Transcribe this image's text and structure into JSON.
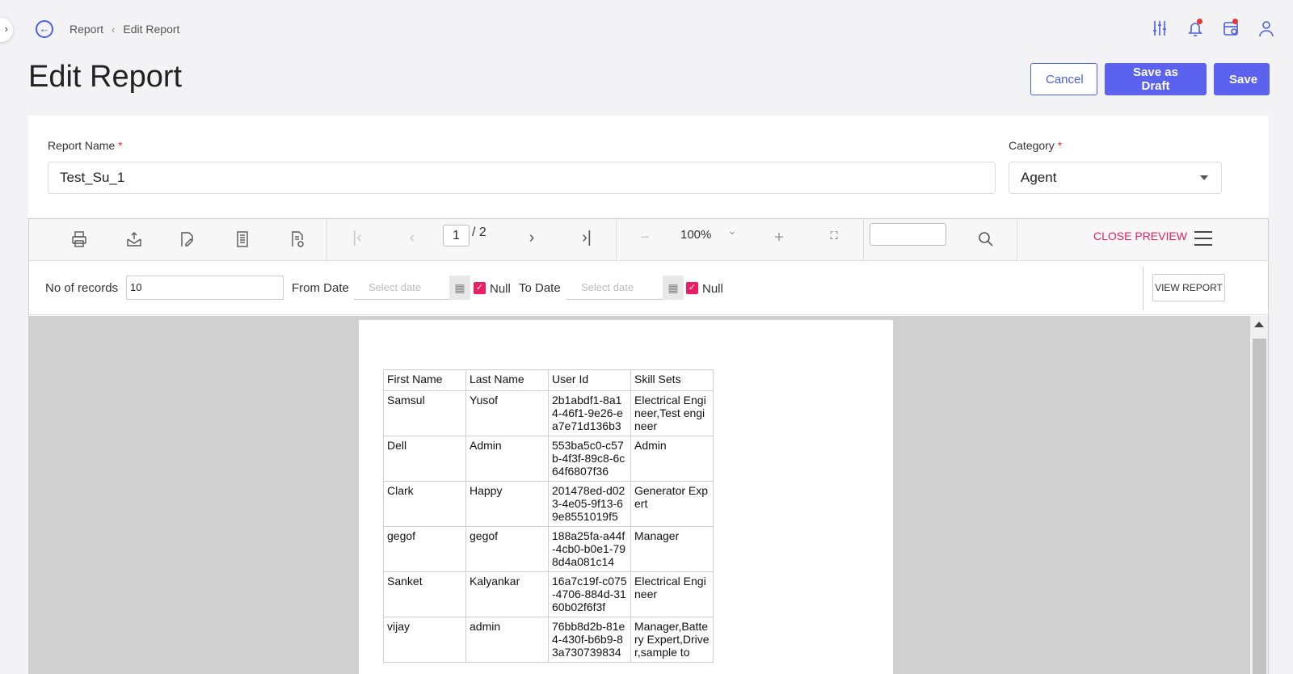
{
  "breadcrumb": {
    "root": "Report",
    "current": "Edit Report"
  },
  "page_title": "Edit Report",
  "actions": {
    "cancel": "Cancel",
    "save_draft": "Save as Draft",
    "save": "Save"
  },
  "form": {
    "report_name_label": "Report Name",
    "report_name_value": "Test_Su_1",
    "category_label": "Category",
    "category_value": "Agent",
    "required_mark": "*"
  },
  "viewer": {
    "current_page": "1",
    "page_total": "/ 2",
    "zoom": "100%",
    "close_preview": "CLOSE PREVIEW"
  },
  "params": {
    "records_label": "No of records",
    "records_value": "10",
    "from_label": "From Date",
    "from_placeholder": "Select date",
    "to_label": "To Date",
    "to_placeholder": "Select date",
    "null_label": "Null",
    "view_report": "VIEW REPORT"
  },
  "report_table": {
    "headers": [
      "First Name",
      "Last Name",
      "User Id",
      "Skill Sets"
    ],
    "rows": [
      [
        "Samsul",
        "Yusof",
        "2b1abdf1-8a14-46f1-9e26-ea7e71d136b3",
        "Electrical Engineer,Test engineer"
      ],
      [
        "Dell",
        "Admin",
        "553ba5c0-c57b-4f3f-89c8-6c64f6807f36",
        "Admin"
      ],
      [
        "Clark",
        "Happy",
        "201478ed-d023-4e05-9f13-69e8551019f5",
        "Generator Expert"
      ],
      [
        "gegof",
        "gegof",
        "188a25fa-a44f-4cb0-b0e1-798d4a081c14",
        "Manager"
      ],
      [
        "Sanket",
        "Kalyankar",
        "16a7c19f-c075-4706-884d-3160b02f6f3f",
        "Electrical Engineer"
      ],
      [
        "vijay",
        "admin",
        "76bb8d2b-81e4-430f-b6b9-83a730739834",
        "Manager,Battery Expert,Driver,sample to"
      ]
    ]
  },
  "accent_color": "#5b62f0",
  "highlight_color": "#e91e63"
}
